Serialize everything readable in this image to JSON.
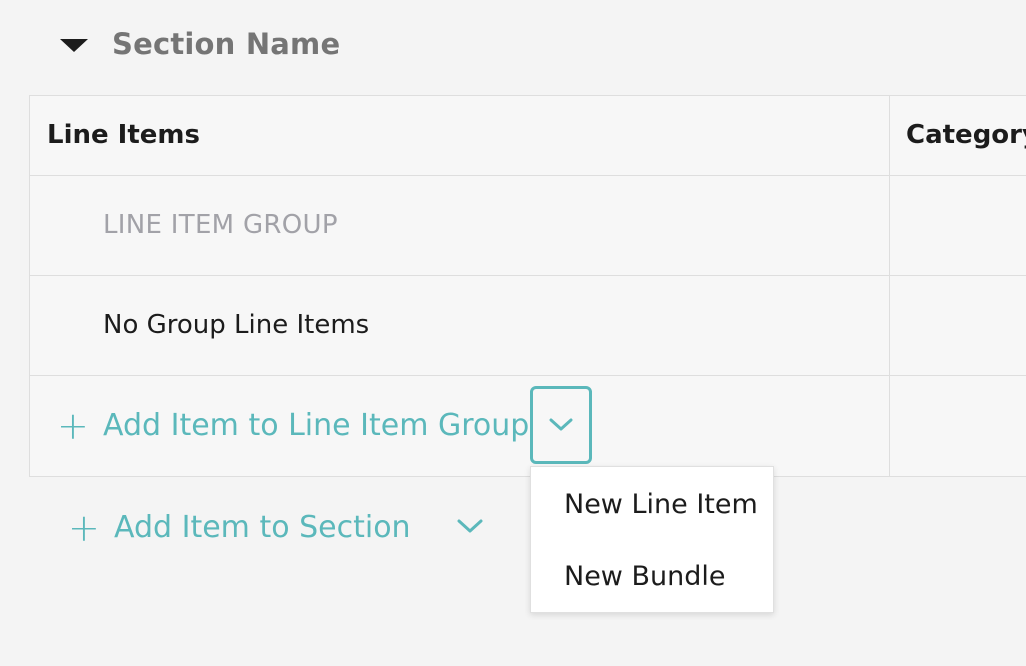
{
  "section": {
    "title": "Section Name",
    "collapse_icon": "caret-down-icon"
  },
  "table": {
    "columns": [
      "Line Items",
      "Category"
    ],
    "group_label": "LINE ITEM GROUP",
    "nogroup_label": "No Group Line Items",
    "add_group_label": "Add Item to Line Item Group",
    "add_icon": "plus-icon",
    "dropdown_icon": "chevron-down-icon"
  },
  "add_section": {
    "label": "Add Item to Section",
    "icon": "plus-icon",
    "dropdown_icon": "chevron-down-icon"
  },
  "menu": {
    "items": [
      "New Line Item",
      "New Bundle"
    ]
  },
  "colors": {
    "accent": "#5bb8bb",
    "text": "#1c1c1c",
    "muted": "#a2a2a8",
    "section_title": "#757575",
    "background": "#f4f4f4"
  }
}
